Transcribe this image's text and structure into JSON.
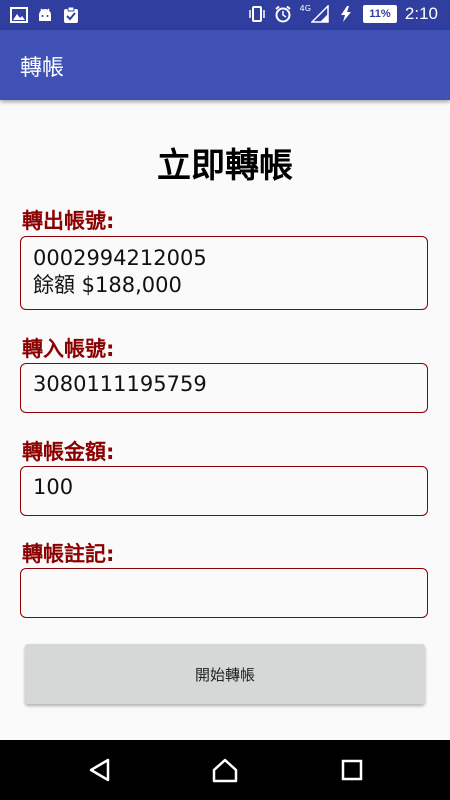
{
  "status_bar": {
    "network": "4G",
    "battery": "11%",
    "time": "2:10"
  },
  "app_bar": {
    "title": "轉帳"
  },
  "form": {
    "heading": "立即轉帳",
    "from_account": {
      "label": "轉出帳號:",
      "account_number": "0002994212005",
      "balance": "餘額 $188,000"
    },
    "to_account": {
      "label": "轉入帳號:",
      "value": "3080111195759"
    },
    "amount": {
      "label": "轉帳金額:",
      "value": "100"
    },
    "note": {
      "label": "轉帳註記:",
      "value": ""
    },
    "submit_label": "開始轉帳"
  }
}
